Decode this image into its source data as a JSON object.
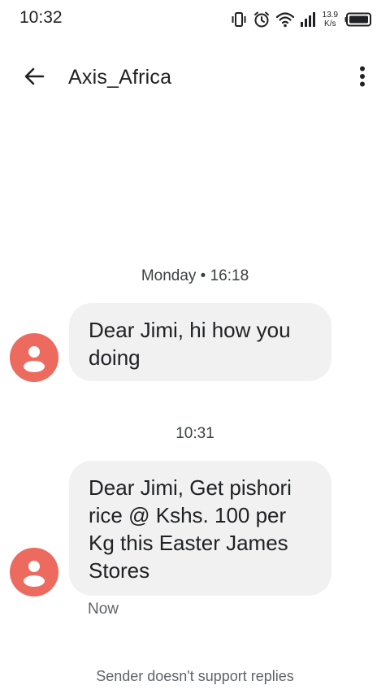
{
  "status_bar": {
    "time": "10:32",
    "net_speed_value": "13.9",
    "net_speed_unit": "K/s",
    "icons": [
      "vibrate-icon",
      "alarm-icon",
      "wifi-icon",
      "signal-icon",
      "battery-icon"
    ]
  },
  "app_bar": {
    "title": "Axis_Africa",
    "back_icon": "arrow-left-icon",
    "menu_icon": "more-vert-icon"
  },
  "conversation": {
    "groups": [
      {
        "timestamp": "Monday • 16:18",
        "message": "Dear Jimi, hi how you doing"
      },
      {
        "timestamp": "10:31",
        "message": "Dear Jimi, Get pishori rice @ Kshs. 100 per Kg this Easter James Stores",
        "status": "Now"
      }
    ]
  },
  "footer": {
    "note": "Sender doesn't support replies"
  },
  "colors": {
    "avatar": "#ec6a5e",
    "bubble": "#f1f1f1",
    "text": "#202124",
    "secondary_text": "#5f6368"
  }
}
